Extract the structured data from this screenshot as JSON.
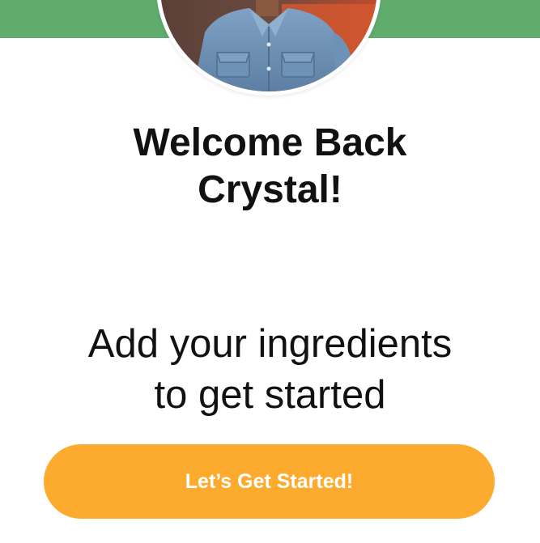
{
  "colors": {
    "header": "#5fac6d",
    "button": "#fcab2f",
    "button_text": "#ffffff",
    "text": "#111111"
  },
  "profile": {
    "avatar": "user-profile-photo"
  },
  "welcome": {
    "line1": "Welcome Back",
    "line2": "Crystal!"
  },
  "prompt": {
    "line1": "Add your ingredients",
    "line2": "to get started"
  },
  "cta": {
    "label": "Let’s Get Started!"
  }
}
